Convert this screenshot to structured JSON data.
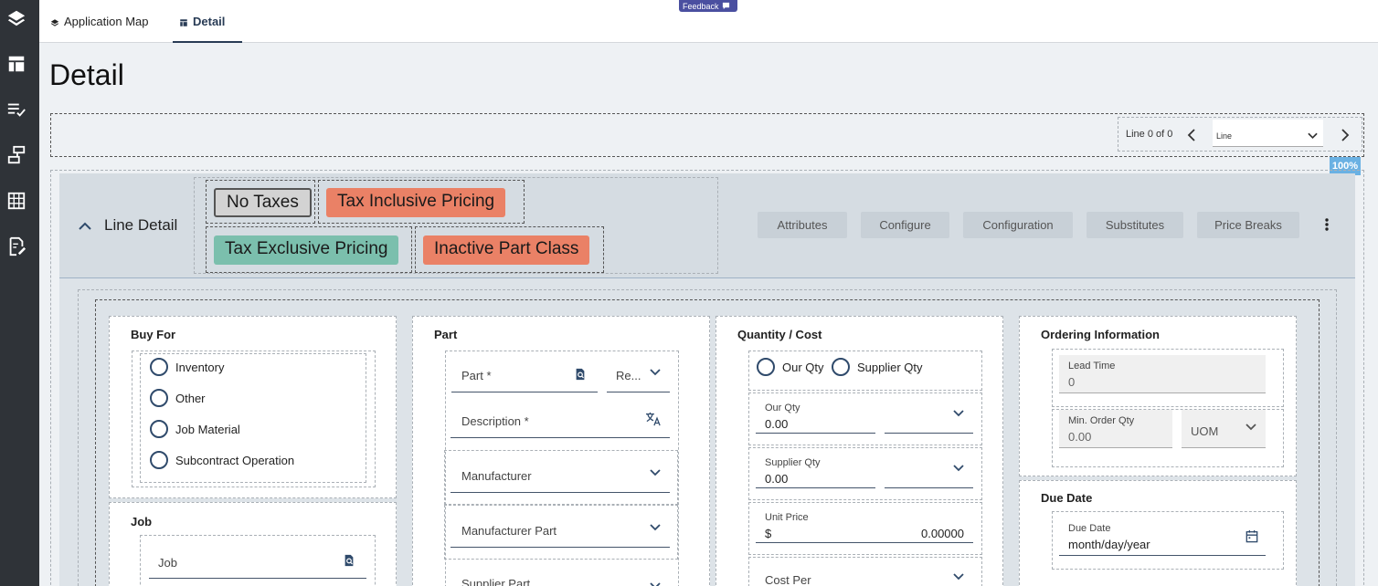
{
  "nav": {
    "feedback": "Feedback",
    "tabs": [
      {
        "label": "Application Map"
      },
      {
        "label": "Detail"
      }
    ]
  },
  "page": {
    "title": "Detail"
  },
  "pager": {
    "label": "Line 0 of 0",
    "select_value": "Line",
    "zoom": "100%"
  },
  "line_detail": {
    "title": "Line Detail",
    "chips": [
      {
        "label": "No Taxes",
        "color": "#d3d3d3"
      },
      {
        "label": "Tax Inclusive Pricing",
        "color": "#ea8166"
      },
      {
        "label": "Tax Exclusive Pricing",
        "color": "#7bbfad"
      },
      {
        "label": "Inactive Part Class",
        "color": "#ea8166"
      }
    ],
    "actions": [
      "Attributes",
      "Configure",
      "Configuration",
      "Substitutes",
      "Price Breaks"
    ]
  },
  "buy_for": {
    "title": "Buy For",
    "options": [
      "Inventory",
      "Other",
      "Job Material",
      "Subcontract Operation"
    ]
  },
  "job": {
    "title": "Job",
    "job_placeholder": "Job"
  },
  "part": {
    "title": "Part",
    "part_label": "Part *",
    "rev_label": "Re...",
    "description_label": "Description *",
    "manufacturer_label": "Manufacturer",
    "manufacturer_part_label": "Manufacturer Part",
    "supplier_part_label": "Supplier Part"
  },
  "qty_cost": {
    "title": "Quantity / Cost",
    "radio_our": "Our Qty",
    "radio_supplier": "Supplier Qty",
    "our_qty_label": "Our Qty",
    "our_qty_value": "0.00",
    "supplier_qty_label": "Supplier Qty",
    "supplier_qty_value": "0.00",
    "unit_price_label": "Unit Price",
    "unit_price_currency": "$",
    "unit_price_value": "0.00000",
    "cost_per_label": "Cost Per"
  },
  "ordering": {
    "title": "Ordering Information",
    "lead_time_label": "Lead Time",
    "lead_time_value": "0",
    "min_order_label": "Min. Order Qty",
    "min_order_value": "0.00",
    "uom_label": "UOM"
  },
  "due_date": {
    "title": "Due Date",
    "field_label": "Due Date",
    "field_value": "month/day/year"
  },
  "colors": {
    "rail": "#2f3338",
    "accent": "#283b55",
    "feedback": "#4a4fa0"
  }
}
